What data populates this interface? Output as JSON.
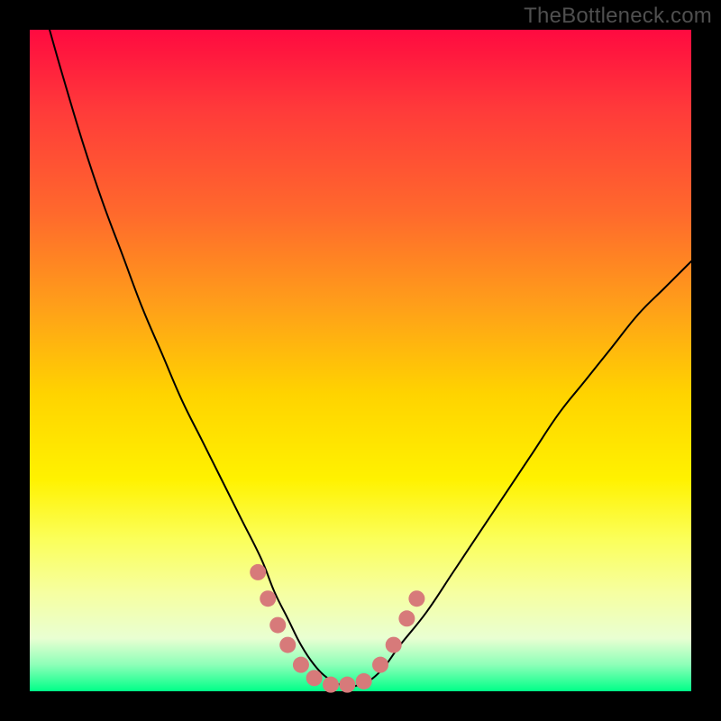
{
  "watermark": "TheBottleneck.com",
  "colors": {
    "frame": "#000000",
    "curve_stroke": "#000000",
    "dot_fill": "#d77a7a",
    "gradient_top": "#ff0a40",
    "gradient_bottom": "#00ff88"
  },
  "chart_data": {
    "type": "line",
    "title": "",
    "xlabel": "",
    "ylabel": "",
    "xlim": [
      0,
      100
    ],
    "ylim": [
      0,
      100
    ],
    "grid": false,
    "series": [
      {
        "name": "bottleneck-curve",
        "x": [
          3,
          5,
          8,
          11,
          14,
          17,
          20,
          23,
          26,
          29,
          32,
          35,
          37,
          39,
          41,
          43,
          45,
          47,
          50,
          53,
          56,
          60,
          64,
          68,
          72,
          76,
          80,
          84,
          88,
          92,
          96,
          100
        ],
        "y": [
          100,
          93,
          83,
          74,
          66,
          58,
          51,
          44,
          38,
          32,
          26,
          20,
          15,
          11,
          7,
          4,
          2,
          1,
          1,
          3,
          7,
          12,
          18,
          24,
          30,
          36,
          42,
          47,
          52,
          57,
          61,
          65
        ]
      }
    ],
    "markers": [
      {
        "x": 34.5,
        "y": 18
      },
      {
        "x": 36,
        "y": 14
      },
      {
        "x": 37.5,
        "y": 10
      },
      {
        "x": 39,
        "y": 7
      },
      {
        "x": 41,
        "y": 4
      },
      {
        "x": 43,
        "y": 2
      },
      {
        "x": 45.5,
        "y": 1
      },
      {
        "x": 48,
        "y": 1
      },
      {
        "x": 50.5,
        "y": 1.5
      },
      {
        "x": 53,
        "y": 4
      },
      {
        "x": 55,
        "y": 7
      },
      {
        "x": 57,
        "y": 11
      },
      {
        "x": 58.5,
        "y": 14
      }
    ]
  }
}
